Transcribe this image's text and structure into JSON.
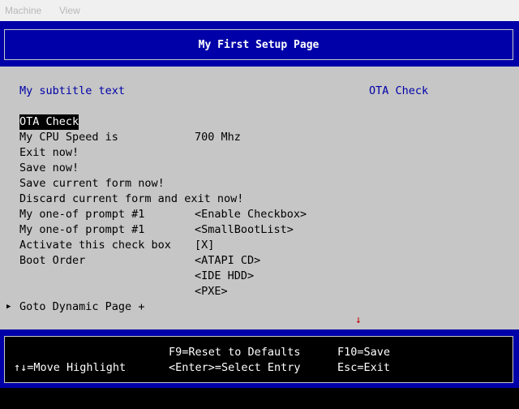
{
  "menubar": {
    "machine": "Machine",
    "view": "View"
  },
  "header": {
    "title": "My First Setup Page"
  },
  "main": {
    "subtitle": "My subtitle text",
    "help_text": "OTA Check",
    "items": [
      {
        "label": "OTA Check",
        "value": ""
      },
      {
        "label": "My CPU Speed is",
        "value": "700 Mhz"
      },
      {
        "label": "Exit now!",
        "value": ""
      },
      {
        "label": "Save now!",
        "value": ""
      },
      {
        "label": "Save current form now!",
        "value": ""
      },
      {
        "label": "Discard current form and exit now!",
        "value": ""
      },
      {
        "label": "My one-of prompt #1",
        "value": "<Enable Checkbox>"
      },
      {
        "label": "My one-of prompt #1",
        "value": "<SmallBootList>"
      },
      {
        "label": "Activate this check box",
        "value": "[X]"
      },
      {
        "label": "Boot Order",
        "value": "<ATAPI CD>"
      },
      {
        "label": "",
        "value": "<IDE HDD>"
      },
      {
        "label": "",
        "value": "<PXE>"
      }
    ],
    "goto": {
      "marker": "▶",
      "label": "Goto Dynamic Page",
      "suffix": "+"
    },
    "scroll_arrow": "↓"
  },
  "footer": {
    "f9": "F9=Reset to Defaults",
    "f10": "F10=Save",
    "move": "↑↓=Move Highlight",
    "enter": "<Enter>=Select Entry",
    "esc": "Esc=Exit"
  },
  "colors": {
    "bios_blue": "#0000a8",
    "bios_gray": "#c6c6c6",
    "highlight_bg": "#000000",
    "scroll_arrow": "#c00000"
  }
}
